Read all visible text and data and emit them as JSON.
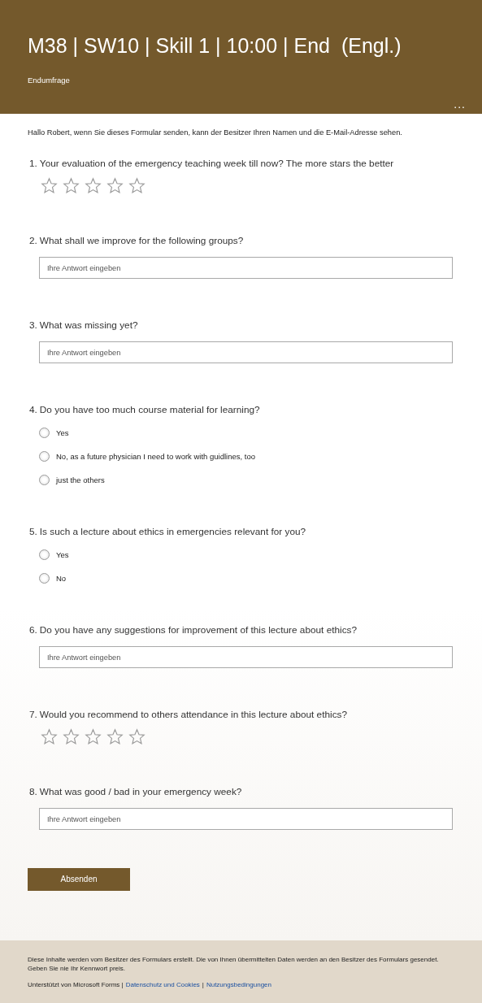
{
  "header": {
    "title": "M38 | SW10 | Skill 1 | 10:00 | End  (Engl.)",
    "subtitle": "Endumfrage",
    "more": "..."
  },
  "notice": "Hallo Robert, wenn Sie dieses Formular senden, kann der Besitzer Ihren Namen und die E-Mail-Adresse sehen.",
  "questions": [
    {
      "number": "1.",
      "text": "Your evaluation of the emergency teaching week till now? The more stars the better",
      "kind": "rating",
      "stars": 0
    },
    {
      "number": "2.",
      "text": "What shall we improve for the following groups?",
      "kind": "text",
      "placeholder": "Ihre Antwort eingeben"
    },
    {
      "number": "3.",
      "text": "What was missing yet?",
      "kind": "text",
      "placeholder": "Ihre Antwort eingeben"
    },
    {
      "number": "4.",
      "text": "Do you have too much course material for learning?",
      "kind": "choice",
      "options": [
        {
          "label": "Yes",
          "selected": false
        },
        {
          "label": "No, as a future physician I need to work with guidlines, too",
          "selected": false
        },
        {
          "label": "just the others",
          "selected": false
        }
      ]
    },
    {
      "number": "5.",
      "text": "Is such a lecture about ethics in emergencies relevant for you?",
      "kind": "choice",
      "options": [
        {
          "label": "Yes",
          "selected": false
        },
        {
          "label": "No",
          "selected": false
        }
      ]
    },
    {
      "number": "6.",
      "text": "Do you have any suggestions for improvement of this lecture about ethics?",
      "kind": "text",
      "placeholder": "Ihre Antwort eingeben"
    },
    {
      "number": "7.",
      "text": "Would you recommend to others attendance in this lecture about ethics?",
      "kind": "rating",
      "stars": 0
    },
    {
      "number": "8.",
      "text": "What was good / bad in your emergency week?",
      "kind": "text",
      "placeholder": "Ihre Antwort eingeben"
    }
  ],
  "submit": "Absenden",
  "footer": {
    "disclaimer": "Diese Inhalte werden vom Besitzer des Formulars erstellt. Die von Ihnen übermittelten Daten werden an den Besitzer des Formulars gesendet. Geben Sie nie Ihr Kennwort preis.",
    "powered": "Unterstützt von Microsoft Forms |",
    "links": [
      "Datenschutz und Cookies",
      "Nutzungsbedingungen"
    ],
    "separator": "|"
  }
}
